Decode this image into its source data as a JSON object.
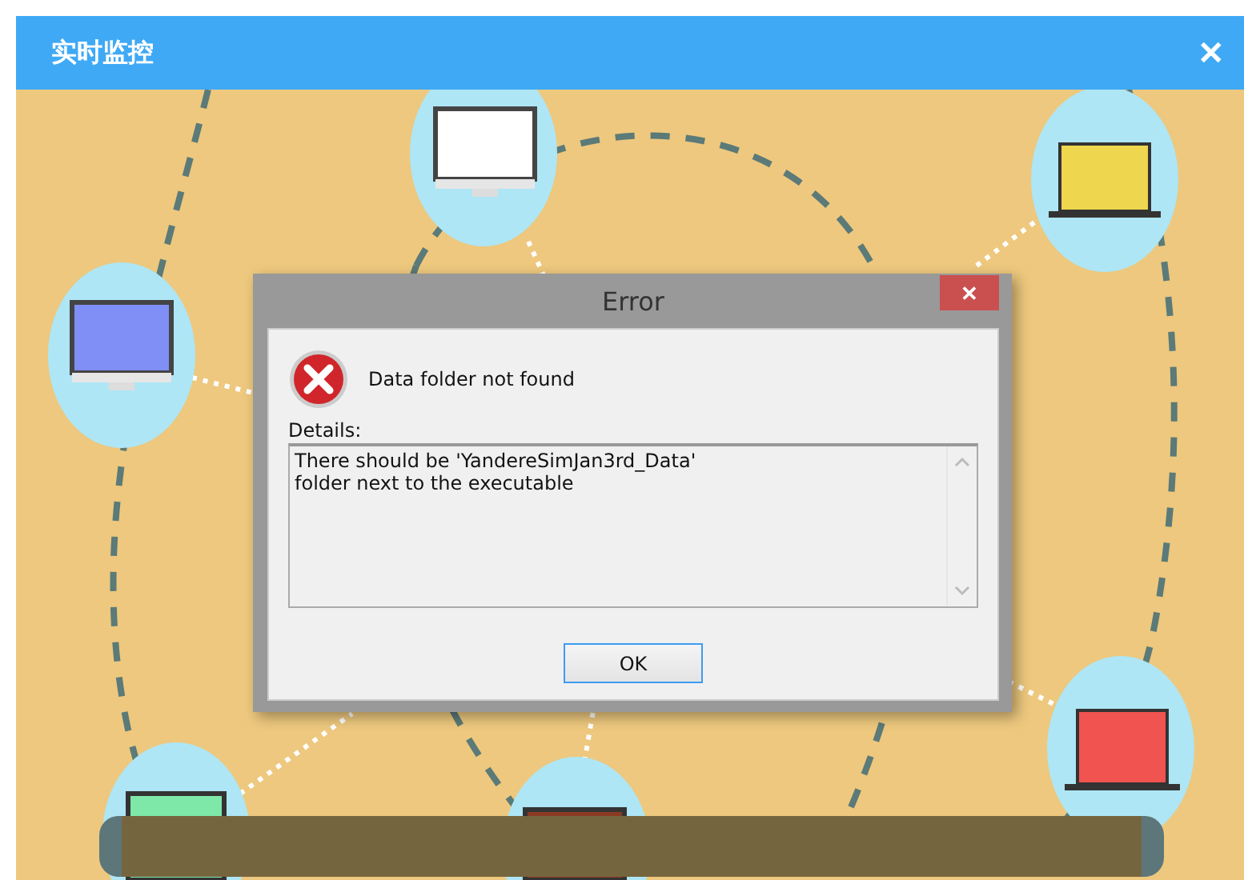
{
  "window": {
    "title": "实时监控",
    "close": "✕"
  },
  "dialog": {
    "title": "Error",
    "close": "✕",
    "message": "Data folder not found",
    "details_label": "Details:",
    "details_lines": [
      "There should be 'YandereSimJan3rd_Data'",
      "folder next to the executable"
    ],
    "button": "OK"
  }
}
